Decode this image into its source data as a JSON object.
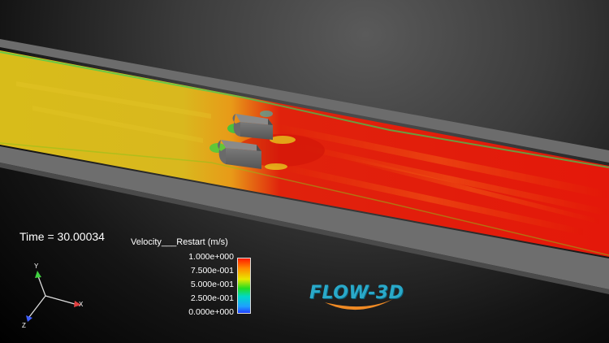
{
  "simulation": {
    "time_label": "Time = 30.00034"
  },
  "legend": {
    "title": "Velocity___Restart (m/s)",
    "ticks": [
      "1.000e+000",
      "7.500e-001",
      "5.000e-001",
      "2.500e-001",
      "0.000e+000"
    ],
    "colormap": [
      "#ff1a00",
      "#ff8a00",
      "#e8e800",
      "#22dd22",
      "#00d8c8",
      "#1fa0ff",
      "#2040ff"
    ]
  },
  "axes": {
    "x_label": "X",
    "y_label": "Y",
    "z_label": "Z",
    "x_color": "#e04040",
    "y_color": "#40d040",
    "z_color": "#4060ff"
  },
  "logo": {
    "text": "FLOW-3D",
    "color": "#2aa9c9",
    "swoosh_color": "#f08a24"
  },
  "colors": {
    "channel_wall": "#6e6e6e",
    "fast_flow": "#e4180a",
    "slow_flow": "#d8b81c"
  }
}
